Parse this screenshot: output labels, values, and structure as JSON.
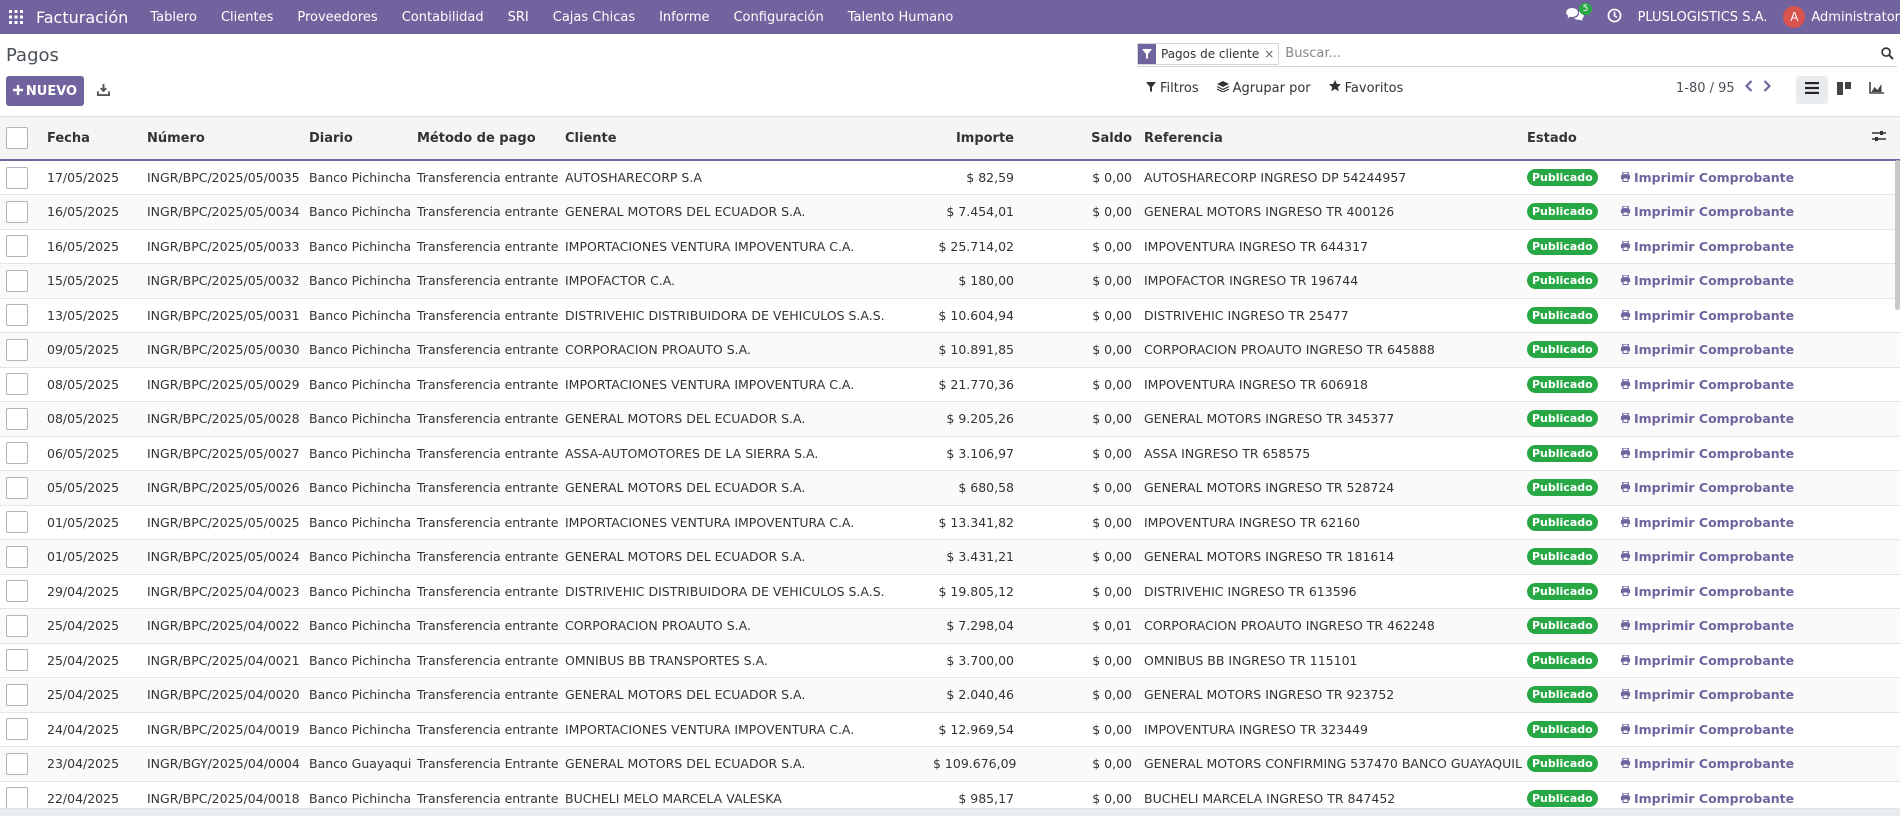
{
  "navbar": {
    "app_name": "Facturación",
    "menu": [
      "Tablero",
      "Clientes",
      "Proveedores",
      "Contabilidad",
      "SRI",
      "Cajas Chicas",
      "Informe",
      "Configuración",
      "Talento Humano"
    ],
    "messages_count": "5",
    "company": "PLUSLOGISTICS S.A.",
    "avatar_letter": "A",
    "user": "Administrator"
  },
  "page": {
    "title": "Pagos",
    "new_button": "NUEVO"
  },
  "search": {
    "facet": "Pagos de cliente",
    "facet_remove": "×",
    "placeholder": "Buscar..."
  },
  "filters": {
    "filters_label": "Filtros",
    "group_label": "Agrupar por",
    "favorites_label": "Favoritos"
  },
  "pager": {
    "value": "1-80 / 95"
  },
  "table": {
    "headers": {
      "fecha": "Fecha",
      "numero": "Número",
      "diario": "Diario",
      "metodo": "Método de pago",
      "cliente": "Cliente",
      "importe": "Importe",
      "saldo": "Saldo",
      "referencia": "Referencia",
      "estado": "Estado"
    },
    "status_label": "Publicado",
    "print_label": "Imprimir Comprobante",
    "rows": [
      {
        "fecha": "17/05/2025",
        "numero": "INGR/BPC/2025/05/0035",
        "diario": "Banco Pichincha",
        "metodo": "Transferencia entrante",
        "cliente": "AUTOSHARECORP S.A",
        "importe": "$ 82,59",
        "saldo": "$ 0,00",
        "referencia": "AUTOSHARECORP INGRESO DP 54244957"
      },
      {
        "fecha": "16/05/2025",
        "numero": "INGR/BPC/2025/05/0034",
        "diario": "Banco Pichincha",
        "metodo": "Transferencia entrante",
        "cliente": "GENERAL MOTORS DEL ECUADOR S.A.",
        "importe": "$ 7.454,01",
        "saldo": "$ 0,00",
        "referencia": "GENERAL MOTORS INGRESO TR 400126"
      },
      {
        "fecha": "16/05/2025",
        "numero": "INGR/BPC/2025/05/0033",
        "diario": "Banco Pichincha",
        "metodo": "Transferencia entrante",
        "cliente": "IMPORTACIONES VENTURA IMPOVENTURA C.A.",
        "importe": "$ 25.714,02",
        "saldo": "$ 0,00",
        "referencia": "IMPOVENTURA INGRESO TR 644317"
      },
      {
        "fecha": "15/05/2025",
        "numero": "INGR/BPC/2025/05/0032",
        "diario": "Banco Pichincha",
        "metodo": "Transferencia entrante",
        "cliente": "IMPOFACTOR C.A.",
        "importe": "$ 180,00",
        "saldo": "$ 0,00",
        "referencia": "IMPOFACTOR INGRESO TR 196744"
      },
      {
        "fecha": "13/05/2025",
        "numero": "INGR/BPC/2025/05/0031",
        "diario": "Banco Pichincha",
        "metodo": "Transferencia entrante",
        "cliente": "DISTRIVEHIC DISTRIBUIDORA DE VEHICULOS S.A.S.",
        "importe": "$ 10.604,94",
        "saldo": "$ 0,00",
        "referencia": "DISTRIVEHIC INGRESO TR 25477"
      },
      {
        "fecha": "09/05/2025",
        "numero": "INGR/BPC/2025/05/0030",
        "diario": "Banco Pichincha",
        "metodo": "Transferencia entrante",
        "cliente": "CORPORACION PROAUTO S.A.",
        "importe": "$ 10.891,85",
        "saldo": "$ 0,00",
        "referencia": "CORPORACION PROAUTO INGRESO TR 645888"
      },
      {
        "fecha": "08/05/2025",
        "numero": "INGR/BPC/2025/05/0029",
        "diario": "Banco Pichincha",
        "metodo": "Transferencia entrante",
        "cliente": "IMPORTACIONES VENTURA IMPOVENTURA C.A.",
        "importe": "$ 21.770,36",
        "saldo": "$ 0,00",
        "referencia": "IMPOVENTURA INGRESO TR 606918"
      },
      {
        "fecha": "08/05/2025",
        "numero": "INGR/BPC/2025/05/0028",
        "diario": "Banco Pichincha",
        "metodo": "Transferencia entrante",
        "cliente": "GENERAL MOTORS DEL ECUADOR S.A.",
        "importe": "$ 9.205,26",
        "saldo": "$ 0,00",
        "referencia": "GENERAL MOTORS INGRESO TR 345377"
      },
      {
        "fecha": "06/05/2025",
        "numero": "INGR/BPC/2025/05/0027",
        "diario": "Banco Pichincha",
        "metodo": "Transferencia entrante",
        "cliente": "ASSA-AUTOMOTORES DE LA SIERRA S.A.",
        "importe": "$ 3.106,97",
        "saldo": "$ 0,00",
        "referencia": "ASSA INGRESO TR 658575"
      },
      {
        "fecha": "05/05/2025",
        "numero": "INGR/BPC/2025/05/0026",
        "diario": "Banco Pichincha",
        "metodo": "Transferencia entrante",
        "cliente": "GENERAL MOTORS DEL ECUADOR S.A.",
        "importe": "$ 680,58",
        "saldo": "$ 0,00",
        "referencia": "GENERAL MOTORS INGRESO TR 528724"
      },
      {
        "fecha": "01/05/2025",
        "numero": "INGR/BPC/2025/05/0025",
        "diario": "Banco Pichincha",
        "metodo": "Transferencia entrante",
        "cliente": "IMPORTACIONES VENTURA IMPOVENTURA C.A.",
        "importe": "$ 13.341,82",
        "saldo": "$ 0,00",
        "referencia": "IMPOVENTURA INGRESO TR 62160"
      },
      {
        "fecha": "01/05/2025",
        "numero": "INGR/BPC/2025/05/0024",
        "diario": "Banco Pichincha",
        "metodo": "Transferencia entrante",
        "cliente": "GENERAL MOTORS DEL ECUADOR S.A.",
        "importe": "$ 3.431,21",
        "saldo": "$ 0,00",
        "referencia": "GENERAL MOTORS INGRESO TR 181614"
      },
      {
        "fecha": "29/04/2025",
        "numero": "INGR/BPC/2025/04/0023",
        "diario": "Banco Pichincha",
        "metodo": "Transferencia entrante",
        "cliente": "DISTRIVEHIC DISTRIBUIDORA DE VEHICULOS S.A.S.",
        "importe": "$ 19.805,12",
        "saldo": "$ 0,00",
        "referencia": "DISTRIVEHIC INGRESO TR 613596"
      },
      {
        "fecha": "25/04/2025",
        "numero": "INGR/BPC/2025/04/0022",
        "diario": "Banco Pichincha",
        "metodo": "Transferencia entrante",
        "cliente": "CORPORACION PROAUTO S.A.",
        "importe": "$ 7.298,04",
        "saldo": "$ 0,01",
        "referencia": "CORPORACION PROAUTO INGRESO TR 462248"
      },
      {
        "fecha": "25/04/2025",
        "numero": "INGR/BPC/2025/04/0021",
        "diario": "Banco Pichincha",
        "metodo": "Transferencia entrante",
        "cliente": "OMNIBUS BB TRANSPORTES S.A.",
        "importe": "$ 3.700,00",
        "saldo": "$ 0,00",
        "referencia": "OMNIBUS BB INGRESO TR 115101"
      },
      {
        "fecha": "25/04/2025",
        "numero": "INGR/BPC/2025/04/0020",
        "diario": "Banco Pichincha",
        "metodo": "Transferencia entrante",
        "cliente": "GENERAL MOTORS DEL ECUADOR S.A.",
        "importe": "$ 2.040,46",
        "saldo": "$ 0,00",
        "referencia": "GENERAL MOTORS INGRESO TR 923752"
      },
      {
        "fecha": "24/04/2025",
        "numero": "INGR/BPC/2025/04/0019",
        "diario": "Banco Pichincha",
        "metodo": "Transferencia entrante",
        "cliente": "IMPORTACIONES VENTURA IMPOVENTURA C.A.",
        "importe": "$ 12.969,54",
        "saldo": "$ 0,00",
        "referencia": "IMPOVENTURA INGRESO TR 323449"
      },
      {
        "fecha": "23/04/2025",
        "numero": "INGR/BGY/2025/04/0004",
        "diario": "Banco Guayaquil",
        "metodo": "Transferencia Entrante",
        "cliente": "GENERAL MOTORS DEL ECUADOR S.A.",
        "importe": "$ 109.676,09",
        "saldo": "$ 0,00",
        "referencia": "GENERAL MOTORS CONFIRMING 537470 BANCO GUAYAQUIL"
      },
      {
        "fecha": "22/04/2025",
        "numero": "INGR/BPC/2025/04/0018",
        "diario": "Banco Pichincha",
        "metodo": "Transferencia entrante",
        "cliente": "BUCHELI MELO MARCELA VALESKA",
        "importe": "$ 985,17",
        "saldo": "$ 0,00",
        "referencia": "BUCHELI MARCELA INGRESO TR 847452"
      }
    ]
  }
}
